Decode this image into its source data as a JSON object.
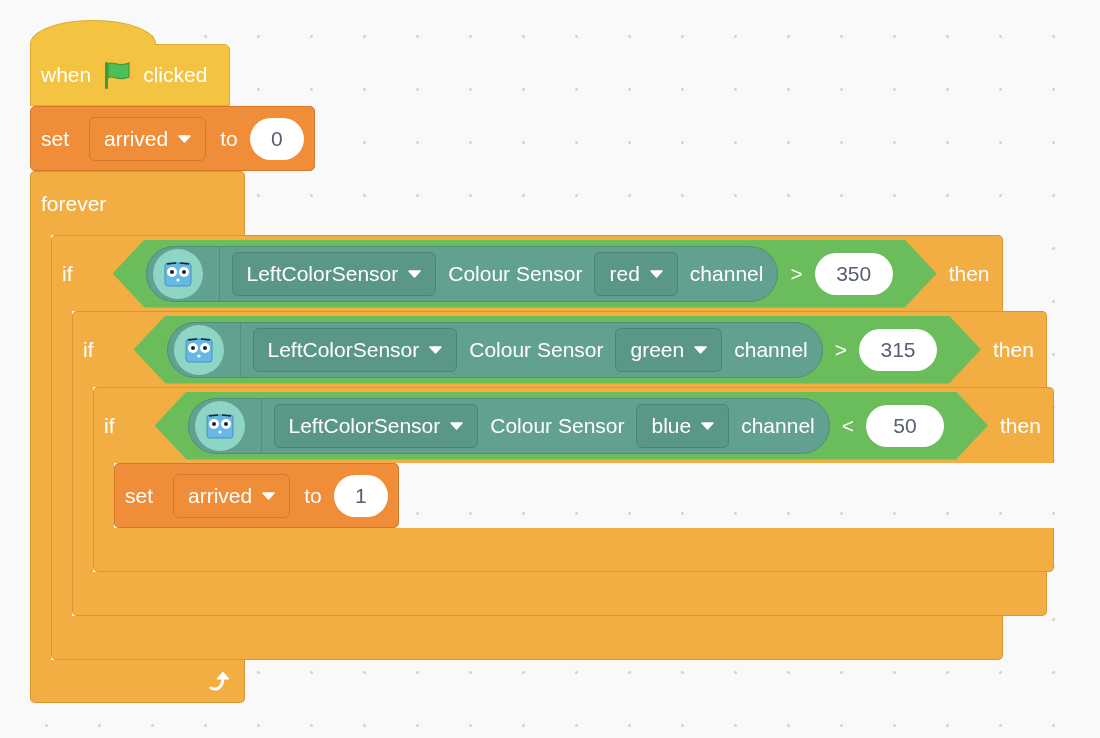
{
  "script": [
    {
      "kind": "hat",
      "label_before": "when",
      "label_after": "clicked"
    },
    {
      "kind": "set",
      "label": "set",
      "variable": "arrived",
      "connector": "to",
      "value": "0"
    },
    {
      "kind": "forever",
      "label": "forever",
      "body": [
        {
          "kind": "if",
          "label": "if",
          "closing": "then",
          "condition": {
            "sensor": "LeftColorSensor",
            "sensor_type": "Colour Sensor",
            "channel": "red",
            "suffix": "channel",
            "operator": ">",
            "value": "350"
          },
          "body": [
            {
              "kind": "if",
              "label": "if",
              "closing": "then",
              "condition": {
                "sensor": "LeftColorSensor",
                "sensor_type": "Colour Sensor",
                "channel": "green",
                "suffix": "channel",
                "operator": ">",
                "value": "315"
              },
              "body": [
                {
                  "kind": "if",
                  "label": "if",
                  "closing": "then",
                  "condition": {
                    "sensor": "LeftColorSensor",
                    "sensor_type": "Colour Sensor",
                    "channel": "blue",
                    "suffix": "channel",
                    "operator": "<",
                    "value": "50"
                  },
                  "body": [
                    {
                      "kind": "set",
                      "label": "set",
                      "variable": "arrived",
                      "connector": "to",
                      "value": "1"
                    }
                  ]
                }
              ]
            }
          ]
        }
      ]
    }
  ]
}
